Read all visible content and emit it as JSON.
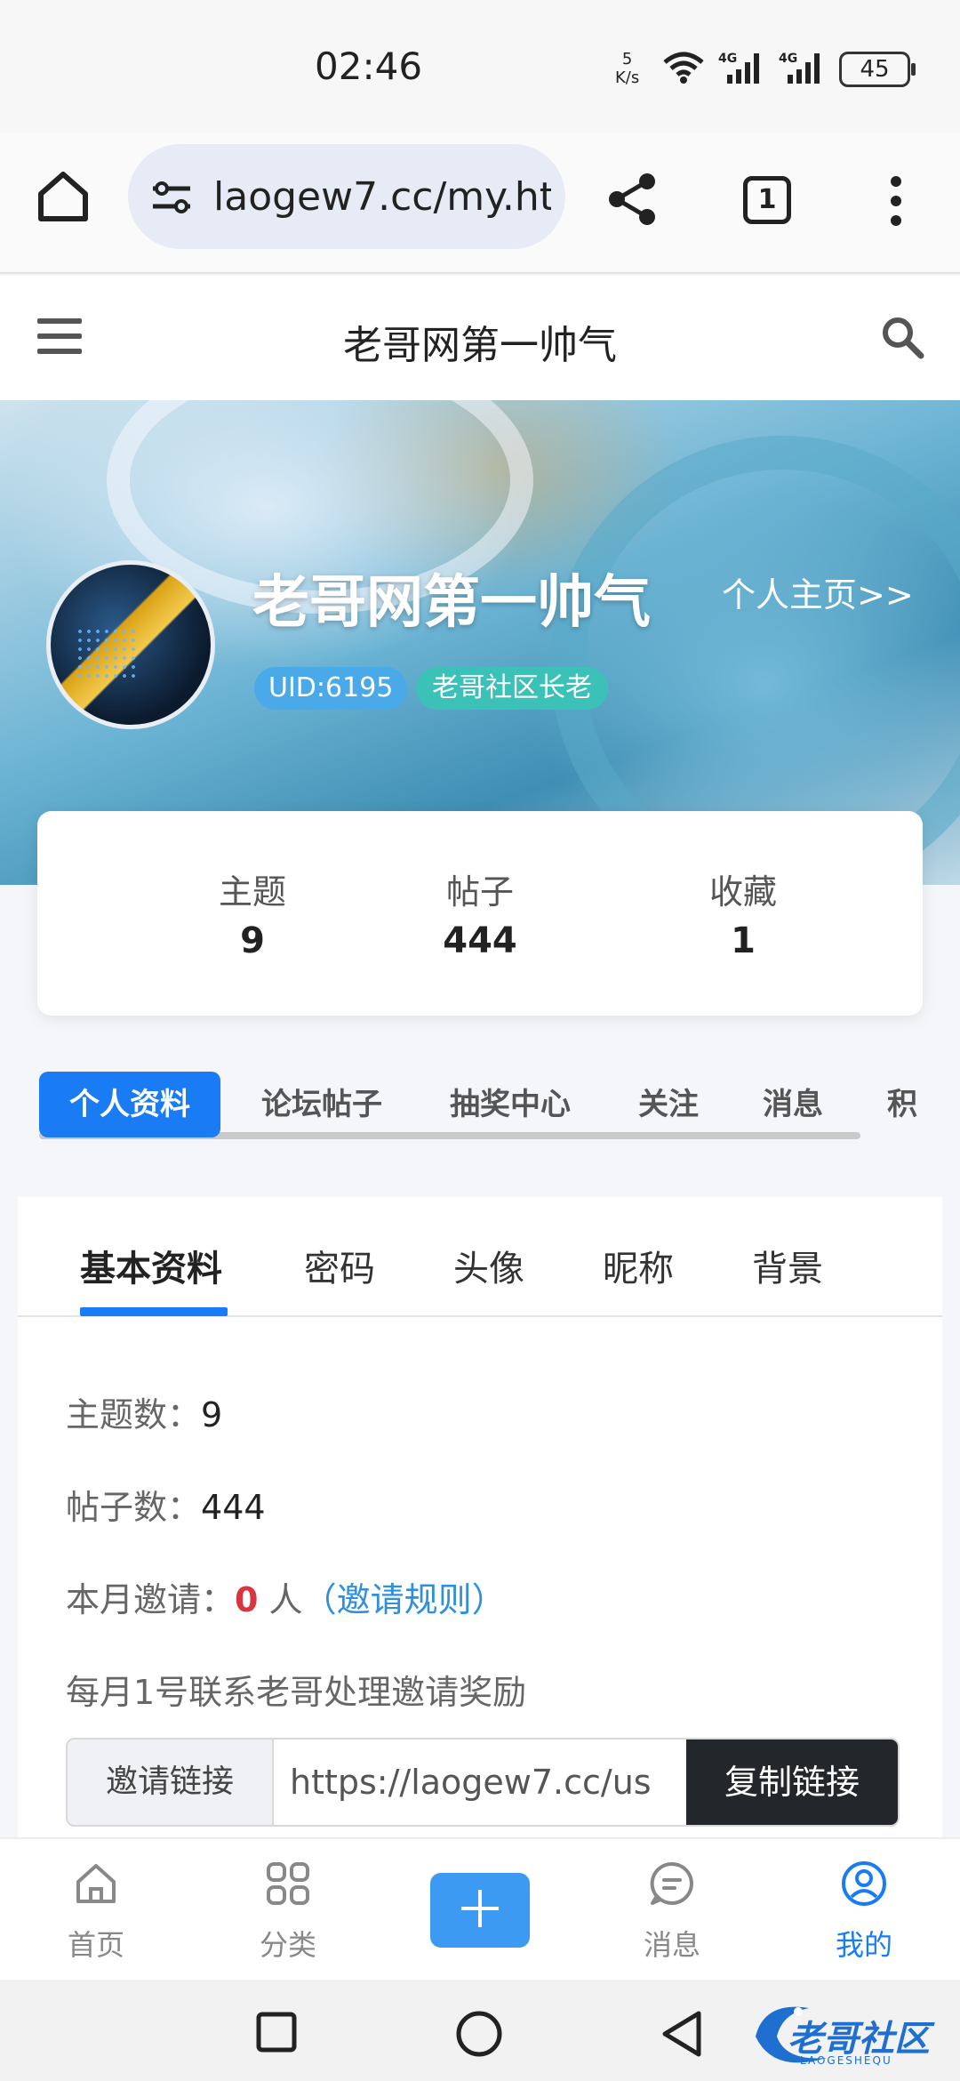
{
  "status_bar": {
    "time": "02:46",
    "net_speed_value": "5",
    "net_speed_unit": "K/s",
    "signal1": "4G",
    "signal2": "4G",
    "battery": "45"
  },
  "browser": {
    "url": "laogew7.cc/my.ht",
    "tab_count": "1"
  },
  "site": {
    "title": "老哥网第一帅气"
  },
  "profile": {
    "username": "老哥网第一帅气",
    "home_link": "个人主页>>",
    "uid": "UID:6195",
    "role": "老哥社区长老"
  },
  "stats": [
    {
      "label": "主题",
      "value": "9"
    },
    {
      "label": "帖子",
      "value": "444"
    },
    {
      "label": "收藏",
      "value": "1"
    }
  ],
  "profile_tabs": [
    "个人资料",
    "论坛帖子",
    "抽奖中心",
    "关注",
    "消息",
    "积"
  ],
  "sub_tabs": [
    "基本资料",
    "密码",
    "头像",
    "昵称",
    "背景"
  ],
  "info": {
    "topics_label": "主题数：",
    "topics_value": "9",
    "posts_label": "帖子数：",
    "posts_value": "444",
    "invite_label": "本月邀请：",
    "invite_value": "0",
    "invite_unit": " 人",
    "invite_rules": "（邀请规则）",
    "monthly_note": "每月1号联系老哥处理邀请奖励",
    "invite_link_label": "邀请链接",
    "invite_link_value": "https://laogew7.cc/us",
    "copy_button": "复制链接"
  },
  "bottom_nav": [
    {
      "label": "首页",
      "icon": "home-icon"
    },
    {
      "label": "分类",
      "icon": "grid-icon"
    },
    {
      "label": "",
      "icon": "plus-icon"
    },
    {
      "label": "消息",
      "icon": "chat-icon"
    },
    {
      "label": "我的",
      "icon": "user-circle-icon"
    }
  ],
  "watermark": {
    "text": "老哥社区",
    "sub": "LAOGESHEQU"
  },
  "colors": {
    "accent": "#1a7cf5",
    "red": "#d9343f",
    "link": "#2f8fdc",
    "uid_badge": "#4aa9e9",
    "role_badge": "#3cc1b8",
    "copy_button": "#23262b"
  }
}
